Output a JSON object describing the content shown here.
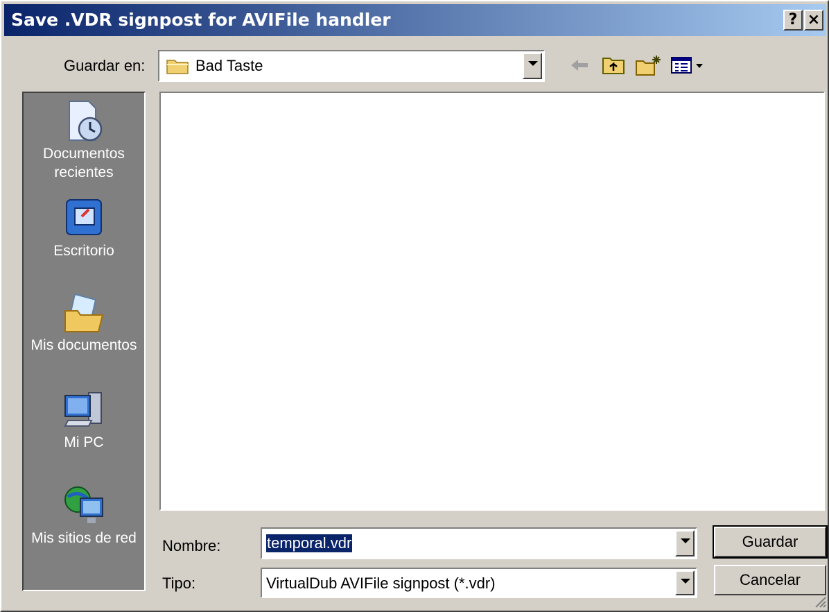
{
  "window": {
    "title": "Save .VDR signpost for AVIFile handler",
    "help_label": "?",
    "close_label": "×"
  },
  "save_in": {
    "label": "Guardar en:",
    "value": "Bad Taste"
  },
  "toolbar": {
    "icons": [
      "back-icon",
      "up-folder-icon",
      "new-folder-icon",
      "view-menu-icon"
    ]
  },
  "places": [
    {
      "label": "Documentos recientes",
      "icon": "recent-documents-icon"
    },
    {
      "label": "Escritorio",
      "icon": "desktop-icon"
    },
    {
      "label": "Mis documentos",
      "icon": "my-documents-icon"
    },
    {
      "label": "Mi PC",
      "icon": "my-computer-icon"
    },
    {
      "label": "Mis sitios de red",
      "icon": "network-places-icon"
    }
  ],
  "filename": {
    "label": "Nombre:",
    "value": "temporal.vdr"
  },
  "filetype": {
    "label": "Tipo:",
    "value": "VirtualDub AVIFile signpost (*.vdr)"
  },
  "buttons": {
    "save": "Guardar",
    "cancel": "Cancelar"
  },
  "colors": {
    "titlebar_start": "#0a246a",
    "titlebar_end": "#a6caf0",
    "selection": "#0a246a"
  }
}
